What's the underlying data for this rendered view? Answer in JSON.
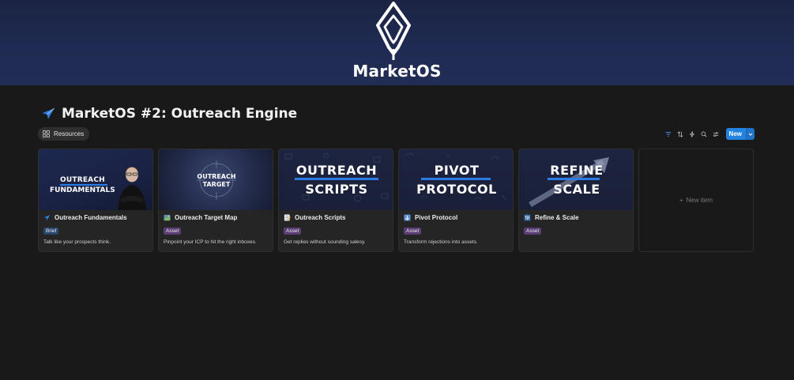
{
  "banner": {
    "brand": "MarketOS"
  },
  "page": {
    "title": "MarketOS #2: Outreach Engine"
  },
  "view": {
    "tab_label": "Resources"
  },
  "toolbar": {
    "new_label": "New"
  },
  "cards": [
    {
      "name": "Outreach Fundamentals",
      "emoji": "paper-plane-icon",
      "tag": "Brief",
      "desc": "Talk like your prospects think.",
      "cover": {
        "line1": "OUTREACH",
        "line2": "FUNDAMENTALS"
      }
    },
    {
      "name": "Outreach Target Map",
      "emoji": "map-icon",
      "tag": "Asset",
      "desc": "Pinpoint your ICP to hit the right inboxes.",
      "cover": {
        "line1": "OUTREACH",
        "line2": "TARGET"
      }
    },
    {
      "name": "Outreach Scripts",
      "emoji": "memo-icon",
      "tag": "Asset",
      "desc": "Get replies without sounding salesy.",
      "cover": {
        "line1": "OUTREACH",
        "line2": "SCRIPTS"
      }
    },
    {
      "name": "Pivot Protocol",
      "emoji": "down-arrow-icon",
      "tag": "Asset",
      "desc": "Transform rejections into assets.",
      "cover": {
        "line1": "PIVOT",
        "line2": "PROTOCOL"
      }
    },
    {
      "name": "Refine & Scale",
      "emoji": "sliders-icon",
      "tag": "Asset",
      "desc": "",
      "cover": {
        "line1": "REFINE",
        "line2": "SCALE"
      }
    }
  ],
  "new_item": {
    "plus": "+",
    "label": "New item"
  },
  "colors": {
    "accent": "#2383e2",
    "brief_tag": "#28456c",
    "asset_tag": "#5a3d74",
    "banner": "#1f2b52"
  }
}
